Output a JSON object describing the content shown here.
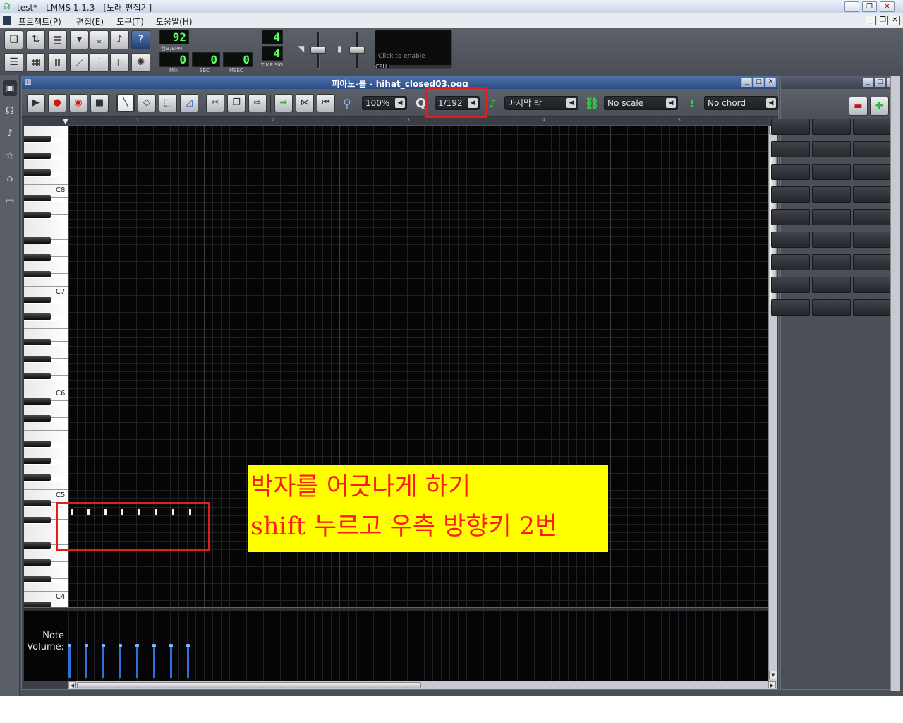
{
  "window": {
    "title": "test* - LMMS 1.1.3 - [노래-편집기]",
    "min": "─",
    "max": "❐",
    "close": "✕"
  },
  "menu": {
    "items": [
      "프로젝트(P)",
      "편집(E)",
      "도구(T)",
      "도움말(H)"
    ],
    "mdi_min": "_",
    "mdi_restore": "❐",
    "mdi_close": "✕"
  },
  "transport": {
    "tempo_value": "92",
    "tempo_label": "템포/BPM",
    "min_value": "0",
    "sec_value": "0",
    "msec_value": "0",
    "min_label": "MIN",
    "sec_label": "SEC",
    "msec_label": "MSEC",
    "timesig_num": "4",
    "timesig_den": "4",
    "timesig_label": "TIME SIG",
    "cpu_click_text": "Click to enable",
    "cpu_label": "CPU"
  },
  "piano_roll": {
    "title": "피아노-롤 - hihat_closed03.ogg",
    "zoom": "100%",
    "quantize": "1/192",
    "note_length": "마지막 박",
    "scale": "No scale",
    "chord": "No chord",
    "bar_numbers": [
      "1",
      "2",
      "3",
      "4",
      "5"
    ],
    "key_labels": [
      {
        "name": "C8",
        "row": 8
      },
      {
        "name": "C7",
        "row": 20
      },
      {
        "name": "C6",
        "row": 32
      },
      {
        "name": "C5",
        "row": 44
      },
      {
        "name": "C4",
        "row": 56
      }
    ],
    "volume_label_1": "Note",
    "volume_label_2": "Volume:",
    "notes": [
      {
        "step": 0
      },
      {
        "step": 2
      },
      {
        "step": 4
      },
      {
        "step": 6
      },
      {
        "step": 8
      },
      {
        "step": 10
      },
      {
        "step": 12
      },
      {
        "step": 14
      }
    ],
    "volume_percent": 100
  },
  "annotation": {
    "line1": "박자를 어긋나게 하기",
    "line2": "shift 누르고 우측 방향키 2번"
  }
}
